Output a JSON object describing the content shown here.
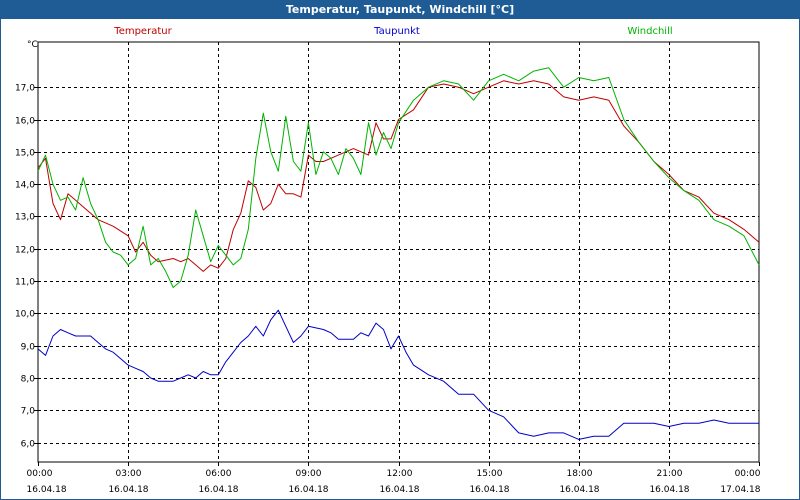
{
  "window": {
    "title": "Temperatur, Taupunkt, Windchill [°C]"
  },
  "chart_data": {
    "type": "line",
    "title": "Temperatur, Taupunkt, Windchill [°C]",
    "ylabel": "°C",
    "ylim": [
      5.4,
      18.4
    ],
    "y_ticks": [
      "6,0",
      "7,0",
      "8,0",
      "9,0",
      "10,0",
      "11,0",
      "12,0",
      "13,0",
      "14,0",
      "15,0",
      "16,0",
      "17,0"
    ],
    "y_tick_values": [
      6,
      7,
      8,
      9,
      10,
      11,
      12,
      13,
      14,
      15,
      16,
      17
    ],
    "xlim": [
      0,
      24
    ],
    "x_tick_values": [
      0,
      3,
      6,
      9,
      12,
      15,
      18,
      21,
      24
    ],
    "x_ticks": [
      {
        "time": "00:00",
        "date": "16.04.18"
      },
      {
        "time": "03:00",
        "date": "16.04.18"
      },
      {
        "time": "06:00",
        "date": "16.04.18"
      },
      {
        "time": "09:00",
        "date": "16.04.18"
      },
      {
        "time": "12:00",
        "date": "16.04.18"
      },
      {
        "time": "15:00",
        "date": "16.04.18"
      },
      {
        "time": "18:00",
        "date": "16.04.18"
      },
      {
        "time": "21:00",
        "date": "16.04.18"
      },
      {
        "time": "00:00",
        "date": "17.04.18"
      }
    ],
    "grid": true,
    "legend_position": "top",
    "series": [
      {
        "name": "Temperatur",
        "color": "#c00000",
        "points": [
          [
            0,
            14.5
          ],
          [
            0.25,
            14.8
          ],
          [
            0.5,
            13.4
          ],
          [
            0.75,
            12.9
          ],
          [
            1.0,
            13.7
          ],
          [
            1.25,
            13.5
          ],
          [
            1.5,
            13.3
          ],
          [
            2.0,
            12.9
          ],
          [
            2.5,
            12.7
          ],
          [
            3.0,
            12.4
          ],
          [
            3.25,
            11.9
          ],
          [
            3.5,
            12.2
          ],
          [
            3.75,
            11.8
          ],
          [
            4.0,
            11.6
          ],
          [
            4.5,
            11.7
          ],
          [
            4.75,
            11.6
          ],
          [
            5.0,
            11.7
          ],
          [
            5.25,
            11.5
          ],
          [
            5.5,
            11.3
          ],
          [
            5.75,
            11.5
          ],
          [
            6.0,
            11.4
          ],
          [
            6.25,
            11.7
          ],
          [
            6.5,
            12.6
          ],
          [
            6.75,
            13.1
          ],
          [
            7.0,
            14.1
          ],
          [
            7.25,
            13.9
          ],
          [
            7.5,
            13.2
          ],
          [
            7.75,
            13.4
          ],
          [
            8.0,
            14.0
          ],
          [
            8.25,
            13.7
          ],
          [
            8.5,
            13.7
          ],
          [
            8.75,
            13.6
          ],
          [
            9.0,
            14.9
          ],
          [
            9.25,
            14.7
          ],
          [
            9.5,
            14.7
          ],
          [
            9.75,
            14.8
          ],
          [
            10.0,
            14.9
          ],
          [
            10.5,
            15.1
          ],
          [
            11.0,
            14.9
          ],
          [
            11.25,
            15.9
          ],
          [
            11.5,
            15.4
          ],
          [
            11.75,
            15.4
          ],
          [
            12.0,
            16.0
          ],
          [
            12.5,
            16.3
          ],
          [
            13.0,
            17.0
          ],
          [
            13.5,
            17.1
          ],
          [
            14.0,
            17.0
          ],
          [
            14.5,
            16.8
          ],
          [
            15.0,
            17.0
          ],
          [
            15.5,
            17.2
          ],
          [
            16.0,
            17.1
          ],
          [
            16.5,
            17.2
          ],
          [
            17.0,
            17.1
          ],
          [
            17.5,
            16.7
          ],
          [
            18.0,
            16.6
          ],
          [
            18.5,
            16.7
          ],
          [
            19.0,
            16.6
          ],
          [
            19.5,
            15.8
          ],
          [
            20.0,
            15.3
          ],
          [
            20.5,
            14.7
          ],
          [
            21.0,
            14.3
          ],
          [
            21.5,
            13.8
          ],
          [
            22.0,
            13.6
          ],
          [
            22.5,
            13.1
          ],
          [
            23.0,
            12.9
          ],
          [
            23.5,
            12.6
          ],
          [
            24.0,
            12.2
          ]
        ]
      },
      {
        "name": "Taupunkt",
        "color": "#0000c8",
        "points": [
          [
            0,
            8.9
          ],
          [
            0.25,
            8.7
          ],
          [
            0.5,
            9.3
          ],
          [
            0.75,
            9.5
          ],
          [
            1.0,
            9.4
          ],
          [
            1.25,
            9.3
          ],
          [
            1.5,
            9.3
          ],
          [
            1.75,
            9.3
          ],
          [
            2.0,
            9.1
          ],
          [
            2.25,
            8.9
          ],
          [
            2.5,
            8.8
          ],
          [
            2.75,
            8.6
          ],
          [
            3.0,
            8.4
          ],
          [
            3.25,
            8.3
          ],
          [
            3.5,
            8.2
          ],
          [
            3.75,
            8.0
          ],
          [
            4.0,
            7.9
          ],
          [
            4.5,
            7.9
          ],
          [
            4.75,
            8.0
          ],
          [
            5.0,
            8.1
          ],
          [
            5.25,
            8.0
          ],
          [
            5.5,
            8.2
          ],
          [
            5.75,
            8.1
          ],
          [
            6.0,
            8.1
          ],
          [
            6.25,
            8.5
          ],
          [
            6.5,
            8.8
          ],
          [
            6.75,
            9.1
          ],
          [
            7.0,
            9.3
          ],
          [
            7.25,
            9.6
          ],
          [
            7.5,
            9.3
          ],
          [
            7.75,
            9.8
          ],
          [
            8.0,
            10.1
          ],
          [
            8.25,
            9.6
          ],
          [
            8.5,
            9.1
          ],
          [
            8.75,
            9.3
          ],
          [
            9.0,
            9.6
          ],
          [
            9.5,
            9.5
          ],
          [
            9.75,
            9.4
          ],
          [
            10.0,
            9.2
          ],
          [
            10.5,
            9.2
          ],
          [
            10.75,
            9.4
          ],
          [
            11.0,
            9.3
          ],
          [
            11.25,
            9.7
          ],
          [
            11.5,
            9.5
          ],
          [
            11.75,
            8.9
          ],
          [
            12.0,
            9.3
          ],
          [
            12.25,
            8.8
          ],
          [
            12.5,
            8.4
          ],
          [
            13.0,
            8.1
          ],
          [
            13.5,
            7.9
          ],
          [
            14.0,
            7.5
          ],
          [
            14.5,
            7.5
          ],
          [
            15.0,
            7.0
          ],
          [
            15.5,
            6.8
          ],
          [
            16.0,
            6.3
          ],
          [
            16.5,
            6.2
          ],
          [
            17.0,
            6.3
          ],
          [
            17.5,
            6.3
          ],
          [
            18.0,
            6.1
          ],
          [
            18.5,
            6.2
          ],
          [
            19.0,
            6.2
          ],
          [
            19.5,
            6.6
          ],
          [
            20.0,
            6.6
          ],
          [
            20.5,
            6.6
          ],
          [
            21.0,
            6.5
          ],
          [
            21.5,
            6.6
          ],
          [
            22.0,
            6.6
          ],
          [
            22.5,
            6.7
          ],
          [
            23.0,
            6.6
          ],
          [
            23.5,
            6.6
          ],
          [
            24.0,
            6.6
          ]
        ]
      },
      {
        "name": "Windchill",
        "color": "#00b400",
        "points": [
          [
            0,
            14.4
          ],
          [
            0.25,
            14.9
          ],
          [
            0.5,
            14.0
          ],
          [
            0.75,
            13.5
          ],
          [
            1.0,
            13.6
          ],
          [
            1.25,
            13.2
          ],
          [
            1.5,
            14.2
          ],
          [
            1.75,
            13.4
          ],
          [
            2.0,
            12.9
          ],
          [
            2.25,
            12.2
          ],
          [
            2.5,
            11.9
          ],
          [
            2.75,
            11.8
          ],
          [
            3.0,
            11.5
          ],
          [
            3.25,
            11.7
          ],
          [
            3.5,
            12.7
          ],
          [
            3.75,
            11.5
          ],
          [
            4.0,
            11.7
          ],
          [
            4.25,
            11.3
          ],
          [
            4.5,
            10.8
          ],
          [
            4.75,
            11.0
          ],
          [
            5.0,
            11.8
          ],
          [
            5.25,
            13.2
          ],
          [
            5.5,
            12.4
          ],
          [
            5.75,
            11.6
          ],
          [
            6.0,
            12.1
          ],
          [
            6.25,
            11.8
          ],
          [
            6.5,
            11.5
          ],
          [
            6.75,
            11.7
          ],
          [
            7.0,
            12.6
          ],
          [
            7.25,
            14.8
          ],
          [
            7.5,
            16.2
          ],
          [
            7.75,
            15.0
          ],
          [
            8.0,
            14.4
          ],
          [
            8.25,
            16.1
          ],
          [
            8.5,
            14.7
          ],
          [
            8.75,
            14.4
          ],
          [
            9.0,
            15.9
          ],
          [
            9.25,
            14.3
          ],
          [
            9.5,
            15.0
          ],
          [
            9.75,
            14.8
          ],
          [
            10.0,
            14.3
          ],
          [
            10.25,
            15.1
          ],
          [
            10.5,
            14.8
          ],
          [
            10.75,
            14.3
          ],
          [
            11.0,
            15.9
          ],
          [
            11.25,
            14.9
          ],
          [
            11.5,
            15.6
          ],
          [
            11.75,
            15.1
          ],
          [
            12.0,
            15.9
          ],
          [
            12.5,
            16.6
          ],
          [
            13.0,
            17.0
          ],
          [
            13.5,
            17.2
          ],
          [
            14.0,
            17.1
          ],
          [
            14.5,
            16.6
          ],
          [
            15.0,
            17.2
          ],
          [
            15.5,
            17.4
          ],
          [
            16.0,
            17.2
          ],
          [
            16.5,
            17.5
          ],
          [
            17.0,
            17.6
          ],
          [
            17.5,
            17.0
          ],
          [
            18.0,
            17.3
          ],
          [
            18.5,
            17.2
          ],
          [
            19.0,
            17.3
          ],
          [
            19.5,
            16.0
          ],
          [
            20.0,
            15.3
          ],
          [
            20.5,
            14.7
          ],
          [
            21.0,
            14.2
          ],
          [
            21.5,
            13.8
          ],
          [
            22.0,
            13.5
          ],
          [
            22.5,
            12.9
          ],
          [
            23.0,
            12.7
          ],
          [
            23.5,
            12.4
          ],
          [
            24.0,
            11.5
          ]
        ]
      }
    ]
  }
}
